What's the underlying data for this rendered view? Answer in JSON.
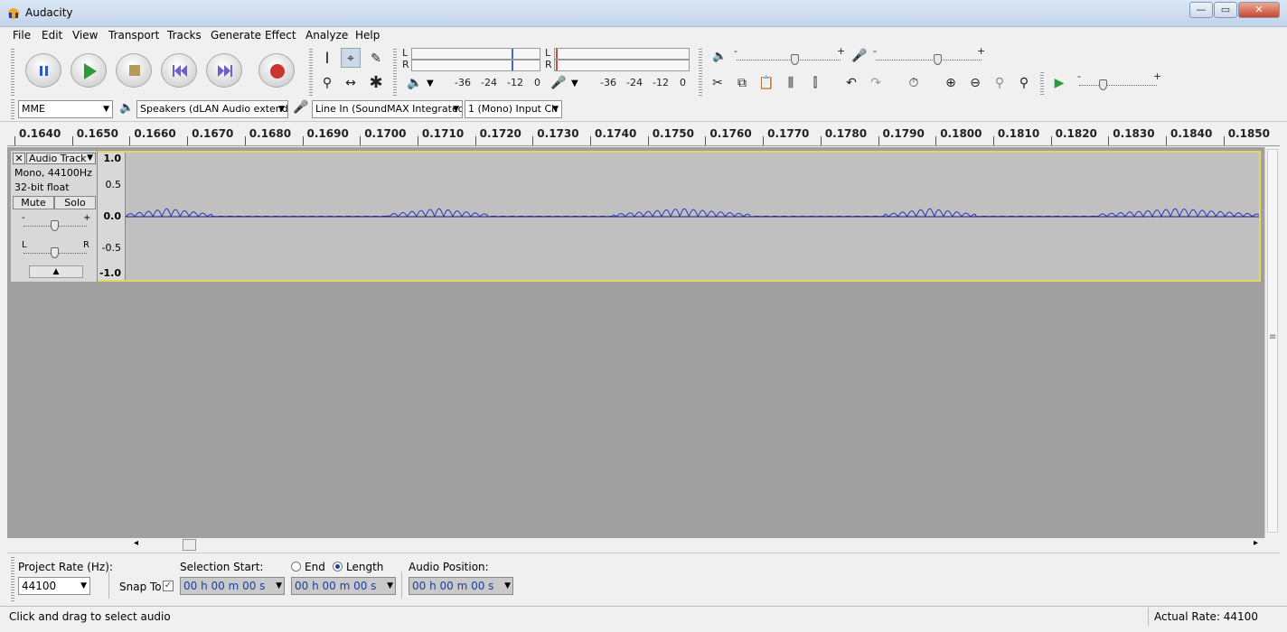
{
  "window": {
    "title": "Audacity",
    "minimize": "—",
    "maximize": "▭",
    "close": "✕"
  },
  "menu": [
    "File",
    "Edit",
    "View",
    "Transport",
    "Tracks",
    "Generate",
    "Effect",
    "Analyze",
    "Help"
  ],
  "meters": {
    "left": "L",
    "right": "R",
    "ticks": [
      "-36",
      "-24",
      "-12",
      "0"
    ]
  },
  "devices": {
    "host": "MME",
    "output": "Speakers (dLAN Audio extende",
    "input": "Line In (SoundMAX Integrated",
    "channels": "1 (Mono) Input Ch"
  },
  "ruler": [
    "0.1640",
    "0.1650",
    "0.1660",
    "0.1670",
    "0.1680",
    "0.1690",
    "0.1700",
    "0.1710",
    "0.1720",
    "0.1730",
    "0.1740",
    "0.1750",
    "0.1760",
    "0.1770",
    "0.1780",
    "0.1790",
    "0.1800",
    "0.1810",
    "0.1820",
    "0.1830",
    "0.1840",
    "0.1850"
  ],
  "track": {
    "name": "Audio Track",
    "close": "✕",
    "info1": "Mono, 44100Hz",
    "info2": "32-bit float",
    "mute": "Mute",
    "solo": "Solo",
    "gain_minus": "-",
    "gain_plus": "+",
    "pan_left": "L",
    "pan_right": "R",
    "scale": [
      "1.0",
      "0.5",
      "0.0",
      "-0.5",
      "-1.0"
    ]
  },
  "selection": {
    "project_rate_label": "Project Rate (Hz):",
    "project_rate": "44100",
    "snap_label": "Snap To",
    "selection_start_label": "Selection Start:",
    "end_label": "End",
    "length_label": "Length",
    "audio_position_label": "Audio Position:",
    "time_value": "00 h 00 m 00 s"
  },
  "status": {
    "message": "Click and drag to select audio",
    "rate": "Actual Rate: 44100"
  },
  "colors": {
    "waveform": "#3232c8",
    "track_border": "#e2d964",
    "selection_digits": "#1a3fa8"
  }
}
